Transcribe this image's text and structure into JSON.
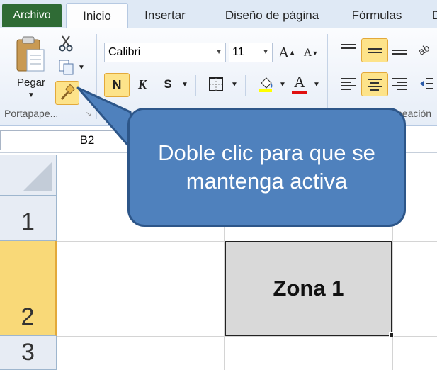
{
  "tabs": {
    "file": "Archivo",
    "home": "Inicio",
    "insert": "Insertar",
    "page_layout": "Diseño de página",
    "formulas": "Fórmulas",
    "more": "D"
  },
  "ribbon": {
    "clipboard": {
      "paste_label": "Pegar",
      "group_label": "Portapape...",
      "icons": [
        "paste-icon",
        "cut-icon",
        "copy-icon",
        "format-painter-icon"
      ]
    },
    "font": {
      "name": "Calibri",
      "size": "11",
      "grow": "A",
      "shrink": "A",
      "bold": "N",
      "italic": "K",
      "underline": "S"
    },
    "alignment": {
      "group_label": "neación"
    }
  },
  "formula_bar": {
    "name_box": "B2"
  },
  "grid": {
    "rows": [
      "1",
      "2",
      "3"
    ],
    "selected_row": "2",
    "cell_b2": "Zona 1"
  },
  "callout": {
    "text": "Doble clic para que se mantenga activa"
  },
  "colors": {
    "callout_fill": "#4f81bd",
    "highlight": "#fde38a",
    "file_tab": "#2f6b35"
  }
}
